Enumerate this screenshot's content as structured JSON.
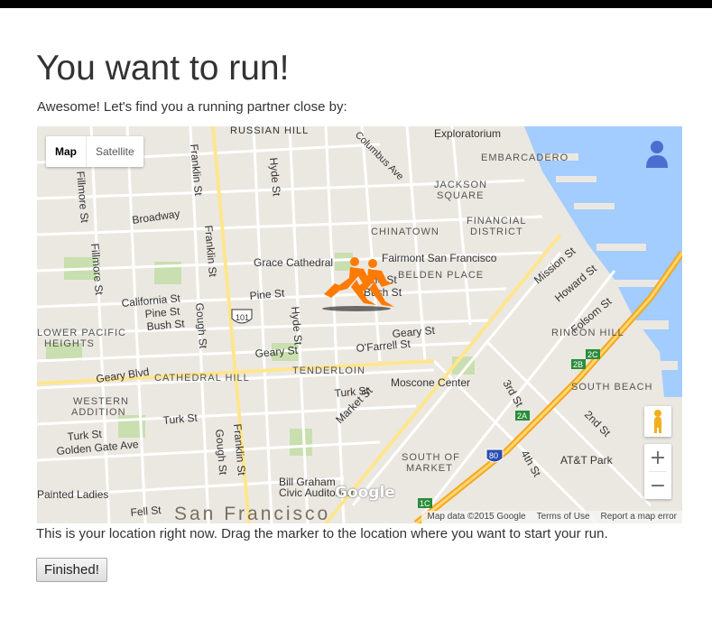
{
  "header": {
    "title": "You want to run!"
  },
  "intro": "Awesome! Let's find you a running partner close by:",
  "map": {
    "type_controls": {
      "map": "Map",
      "satellite": "Satellite"
    },
    "labels": {
      "russian_hill": "RUSSIAN HILL",
      "columbus": "Columbus Ave",
      "exploratorium": "Exploratorium",
      "embarcadero": "EMBARCADERO",
      "jackson_square": "JACKSON",
      "jackson_square2": "SQUARE",
      "financial": "FINANCIAL",
      "financial2": "DISTRICT",
      "chinatown": "CHINATOWN",
      "fairmont": "Fairmont San Francisco",
      "belden": "BELDEN PLACE",
      "grace": "Grace Cathedral",
      "mission_st": "Mission St",
      "howard_st": "Howard St",
      "folsom_st": "Folsom St",
      "rincon": "RINCON HILL",
      "broadway": "Broadway",
      "fillmore1": "Fillmore St",
      "fillmore2": "Fillmore St",
      "franklin1": "Franklin St",
      "franklin2": "Franklin St",
      "franklin3": "Franklin St",
      "hyde1": "Hyde St",
      "hyde2": "Hyde St",
      "california": "California St",
      "pine1": "Pine St",
      "pine2": "Pine St",
      "pine3": "Pine St",
      "bush1": "Bush St",
      "bush2": "Bush St",
      "gough1": "Gough St",
      "gough2": "Gough St",
      "lower_pacific": "LOWER PACIFIC",
      "heights": "HEIGHTS",
      "geary1": "Geary St",
      "geary2": "Geary St",
      "geary_blvd": "Geary Blvd",
      "ofarrell": "O'Farrell St",
      "cathedral_hill": "CATHEDRAL HILL",
      "tenderloin": "TENDERLOIN",
      "moscone": "Moscone Center",
      "third": "3rd St",
      "south_beach": "SOUTH BEACH",
      "western1": "WESTERN",
      "western2": "ADDITION",
      "turk1": "Turk St",
      "turk2": "Turk St",
      "turk3": "Turk St",
      "market": "Market St",
      "second": "2nd St",
      "golden_gate": "Golden Gate Ave",
      "som1": "SOUTH OF",
      "som2": "MARKET",
      "fourth": "4th St",
      "att": "AT&T Park",
      "bill_graham": "Bill Graham",
      "civic": "Civic Auditorium",
      "painted": "Painted Ladies",
      "fell": "Fell St",
      "sf": "San Francisco",
      "hwy101": "101",
      "i80": "80",
      "r2a": "2A",
      "r2b": "2B",
      "r2c": "2C",
      "r1c": "1C",
      "google": "Google"
    },
    "attribution": {
      "data": "Map data ©2015 Google",
      "terms": "Terms of Use",
      "report": "Report a map error"
    },
    "colors": {
      "water": "#a3ccff",
      "park": "#c9dfaf",
      "highway": "#f9b233",
      "arterial": "#ffe68e",
      "marker": "#ff7a00"
    }
  },
  "hint": "This is your location right now. Drag the marker to the location where you want to start your run.",
  "finish_button": "Finished!"
}
